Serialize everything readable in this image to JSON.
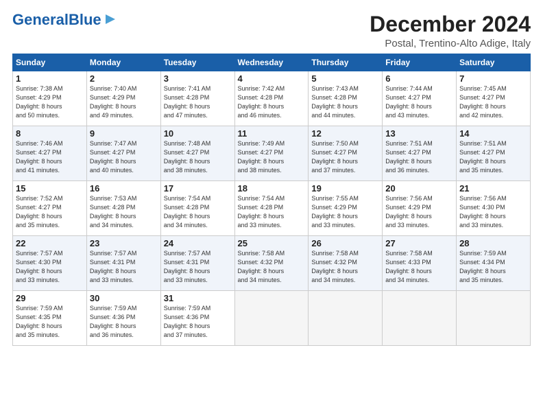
{
  "header": {
    "logo_general": "General",
    "logo_blue": "Blue",
    "month_title": "December 2024",
    "location": "Postal, Trentino-Alto Adige, Italy"
  },
  "columns": [
    "Sunday",
    "Monday",
    "Tuesday",
    "Wednesday",
    "Thursday",
    "Friday",
    "Saturday"
  ],
  "weeks": [
    [
      {
        "day": "1",
        "info": "Sunrise: 7:38 AM\nSunset: 4:29 PM\nDaylight: 8 hours\nand 50 minutes."
      },
      {
        "day": "2",
        "info": "Sunrise: 7:40 AM\nSunset: 4:29 PM\nDaylight: 8 hours\nand 49 minutes."
      },
      {
        "day": "3",
        "info": "Sunrise: 7:41 AM\nSunset: 4:28 PM\nDaylight: 8 hours\nand 47 minutes."
      },
      {
        "day": "4",
        "info": "Sunrise: 7:42 AM\nSunset: 4:28 PM\nDaylight: 8 hours\nand 46 minutes."
      },
      {
        "day": "5",
        "info": "Sunrise: 7:43 AM\nSunset: 4:28 PM\nDaylight: 8 hours\nand 44 minutes."
      },
      {
        "day": "6",
        "info": "Sunrise: 7:44 AM\nSunset: 4:27 PM\nDaylight: 8 hours\nand 43 minutes."
      },
      {
        "day": "7",
        "info": "Sunrise: 7:45 AM\nSunset: 4:27 PM\nDaylight: 8 hours\nand 42 minutes."
      }
    ],
    [
      {
        "day": "8",
        "info": "Sunrise: 7:46 AM\nSunset: 4:27 PM\nDaylight: 8 hours\nand 41 minutes."
      },
      {
        "day": "9",
        "info": "Sunrise: 7:47 AM\nSunset: 4:27 PM\nDaylight: 8 hours\nand 40 minutes."
      },
      {
        "day": "10",
        "info": "Sunrise: 7:48 AM\nSunset: 4:27 PM\nDaylight: 8 hours\nand 38 minutes."
      },
      {
        "day": "11",
        "info": "Sunrise: 7:49 AM\nSunset: 4:27 PM\nDaylight: 8 hours\nand 38 minutes."
      },
      {
        "day": "12",
        "info": "Sunrise: 7:50 AM\nSunset: 4:27 PM\nDaylight: 8 hours\nand 37 minutes."
      },
      {
        "day": "13",
        "info": "Sunrise: 7:51 AM\nSunset: 4:27 PM\nDaylight: 8 hours\nand 36 minutes."
      },
      {
        "day": "14",
        "info": "Sunrise: 7:51 AM\nSunset: 4:27 PM\nDaylight: 8 hours\nand 35 minutes."
      }
    ],
    [
      {
        "day": "15",
        "info": "Sunrise: 7:52 AM\nSunset: 4:27 PM\nDaylight: 8 hours\nand 35 minutes."
      },
      {
        "day": "16",
        "info": "Sunrise: 7:53 AM\nSunset: 4:28 PM\nDaylight: 8 hours\nand 34 minutes."
      },
      {
        "day": "17",
        "info": "Sunrise: 7:54 AM\nSunset: 4:28 PM\nDaylight: 8 hours\nand 34 minutes."
      },
      {
        "day": "18",
        "info": "Sunrise: 7:54 AM\nSunset: 4:28 PM\nDaylight: 8 hours\nand 33 minutes."
      },
      {
        "day": "19",
        "info": "Sunrise: 7:55 AM\nSunset: 4:29 PM\nDaylight: 8 hours\nand 33 minutes."
      },
      {
        "day": "20",
        "info": "Sunrise: 7:56 AM\nSunset: 4:29 PM\nDaylight: 8 hours\nand 33 minutes."
      },
      {
        "day": "21",
        "info": "Sunrise: 7:56 AM\nSunset: 4:30 PM\nDaylight: 8 hours\nand 33 minutes."
      }
    ],
    [
      {
        "day": "22",
        "info": "Sunrise: 7:57 AM\nSunset: 4:30 PM\nDaylight: 8 hours\nand 33 minutes."
      },
      {
        "day": "23",
        "info": "Sunrise: 7:57 AM\nSunset: 4:31 PM\nDaylight: 8 hours\nand 33 minutes."
      },
      {
        "day": "24",
        "info": "Sunrise: 7:57 AM\nSunset: 4:31 PM\nDaylight: 8 hours\nand 33 minutes."
      },
      {
        "day": "25",
        "info": "Sunrise: 7:58 AM\nSunset: 4:32 PM\nDaylight: 8 hours\nand 34 minutes."
      },
      {
        "day": "26",
        "info": "Sunrise: 7:58 AM\nSunset: 4:32 PM\nDaylight: 8 hours\nand 34 minutes."
      },
      {
        "day": "27",
        "info": "Sunrise: 7:58 AM\nSunset: 4:33 PM\nDaylight: 8 hours\nand 34 minutes."
      },
      {
        "day": "28",
        "info": "Sunrise: 7:59 AM\nSunset: 4:34 PM\nDaylight: 8 hours\nand 35 minutes."
      }
    ],
    [
      {
        "day": "29",
        "info": "Sunrise: 7:59 AM\nSunset: 4:35 PM\nDaylight: 8 hours\nand 35 minutes."
      },
      {
        "day": "30",
        "info": "Sunrise: 7:59 AM\nSunset: 4:36 PM\nDaylight: 8 hours\nand 36 minutes."
      },
      {
        "day": "31",
        "info": "Sunrise: 7:59 AM\nSunset: 4:36 PM\nDaylight: 8 hours\nand 37 minutes."
      },
      null,
      null,
      null,
      null
    ]
  ]
}
